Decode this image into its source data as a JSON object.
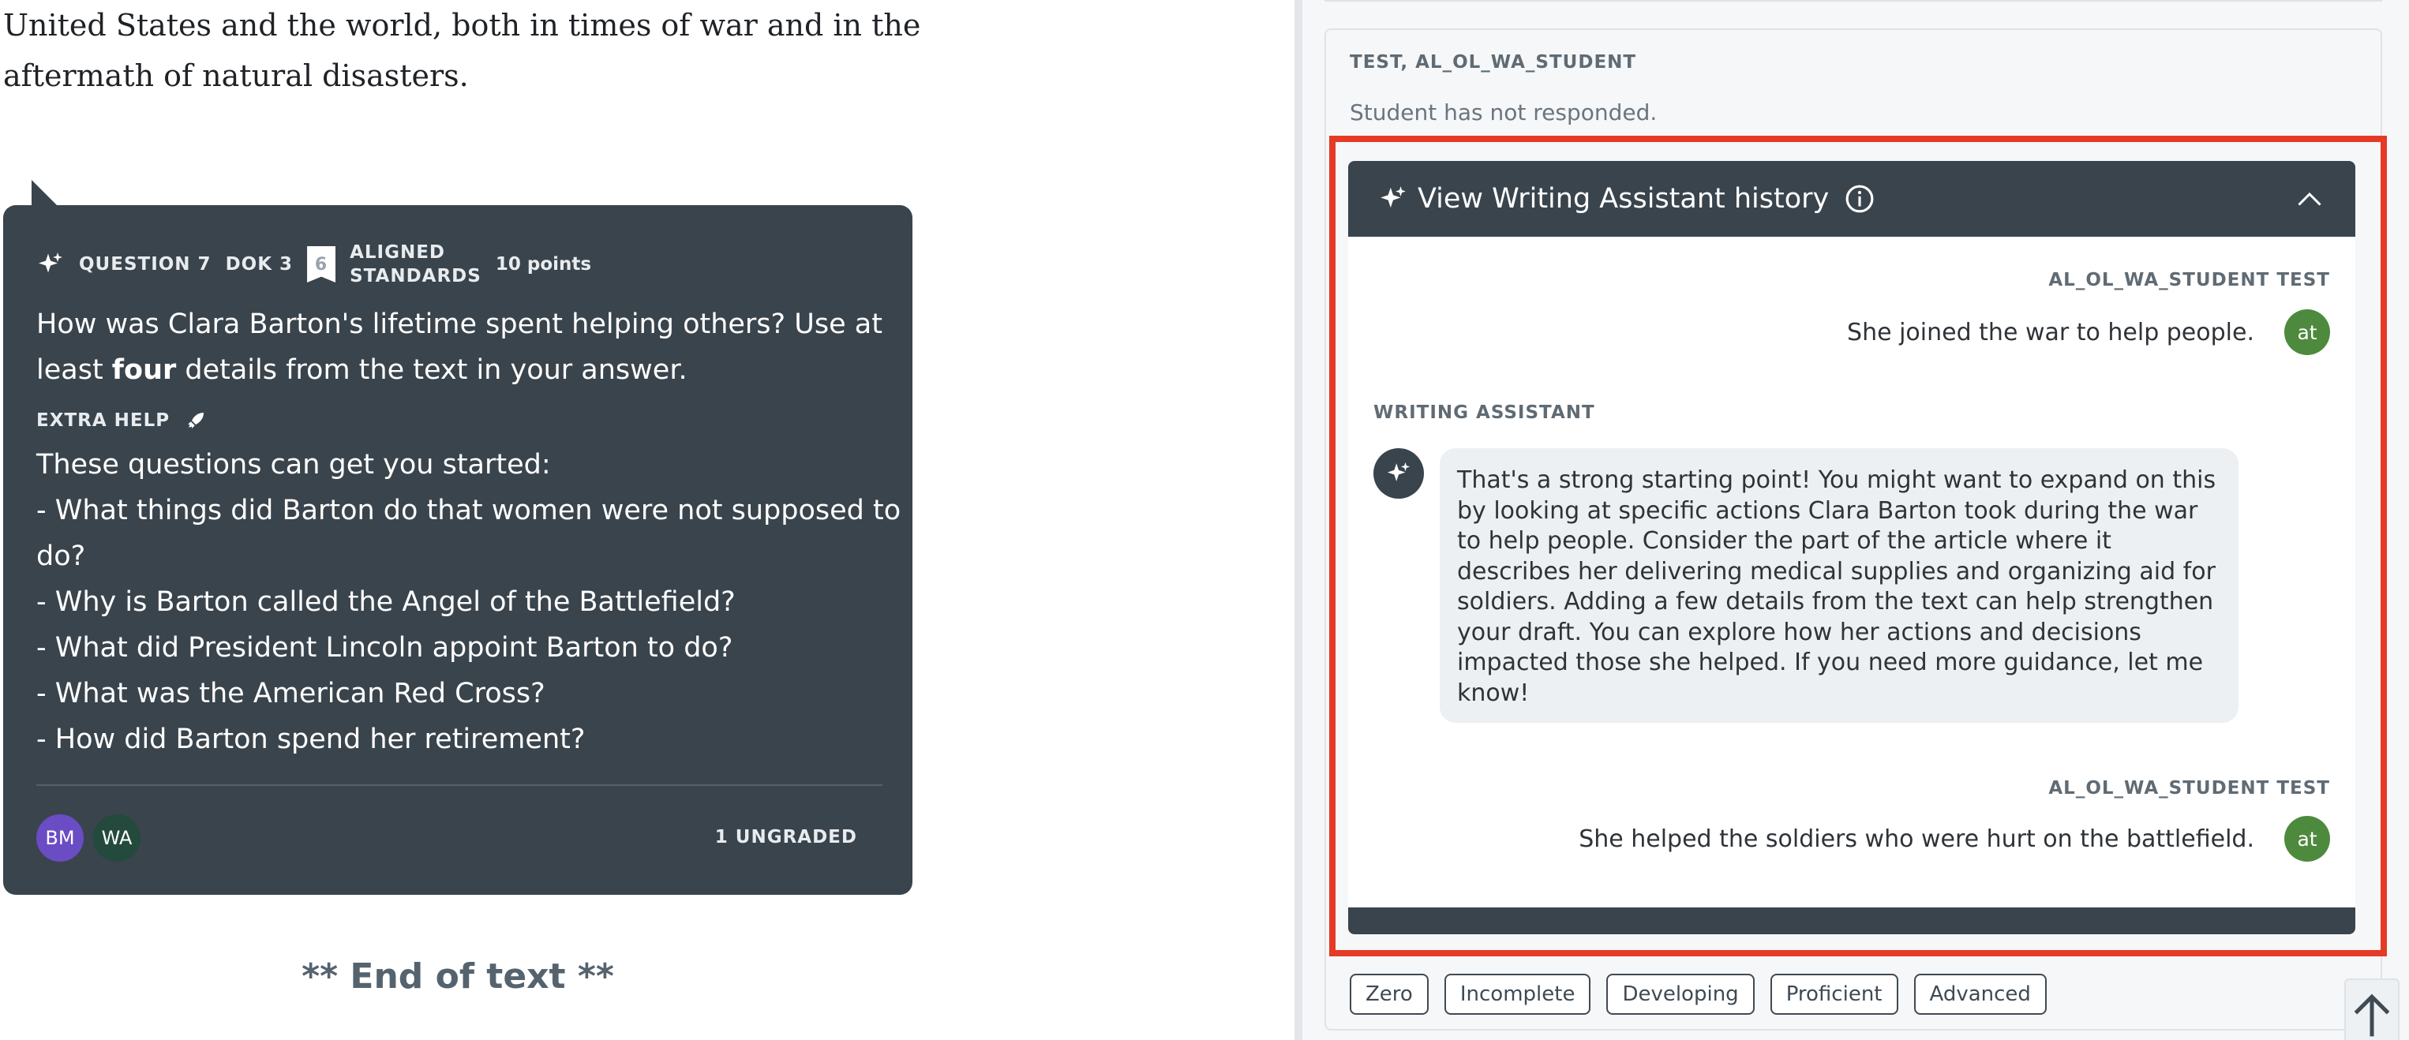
{
  "article": {
    "line1": "United States and the world, both in times of war and in the",
    "line2": "aftermath of natural disasters.",
    "end_text": "** End of text **"
  },
  "question": {
    "number": "QUESTION 7",
    "dok": "DOK 3",
    "standards_count": "6",
    "standards_label_1": "ALIGNED",
    "standards_label_2": "STANDARDS",
    "points": "10 points",
    "prompt_part1": "How was Clara Barton's lifetime spent helping others? Use at least ",
    "prompt_emph": "four",
    "prompt_part2": " details from the text in your answer.",
    "extra_help_label": "EXTRA HELP",
    "help_items": [
      "These questions can get you started:",
      "- What things did Barton do that women were not supposed to do?",
      "- Why is Barton called the Angel of the Battlefield?",
      "- What did President Lincoln appoint Barton to do?",
      "- What was the American Red Cross?",
      "- How did Barton spend her retirement?"
    ],
    "avatars": [
      "BM",
      "WA"
    ],
    "ungraded": "1 UNGRADED"
  },
  "grading": {
    "student_name": "TEST, AL_OL_WA_STUDENT",
    "student_status": "Student has not responded.",
    "wa_title": "View Writing Assistant history",
    "messages": {
      "author1": "AL_OL_WA_STUDENT TEST",
      "text1": "She joined the war to help people.",
      "avatar1": "at",
      "assistant_label": "WRITING ASSISTANT",
      "assistant_text": "That's a strong starting point! You might want to expand on this by looking at specific actions Clara Barton took during the war to help people. Consider the part of the article where it describes her delivering medical supplies and organizing aid for soldiers. Adding a few details from the text can help strengthen your draft. You can explore how her actions and decisions impacted those she helped. If you need more guidance, let me know!",
      "author2": "AL_OL_WA_STUDENT TEST",
      "text2": "She helped the soldiers who were hurt on the battlefield.",
      "avatar2": "at"
    },
    "rubric": [
      "Zero",
      "Incomplete",
      "Developing",
      "Proficient",
      "Advanced"
    ]
  },
  "colors": {
    "card_dark": "#3a444c",
    "highlight_red": "#e43a26",
    "student_avatar_green": "#4d8a3d",
    "bm_avatar_purple": "#6a4cc4",
    "wa_avatar_green": "#234a3c"
  },
  "icons": {
    "question": "sparkle-icon",
    "standards": "bookmark-icon",
    "extra_help": "rocket-icon",
    "wa_header": "sparkle-icon",
    "info": "info-icon",
    "collapse": "chevron-up-icon",
    "scroll_top": "arrow-up-icon"
  }
}
